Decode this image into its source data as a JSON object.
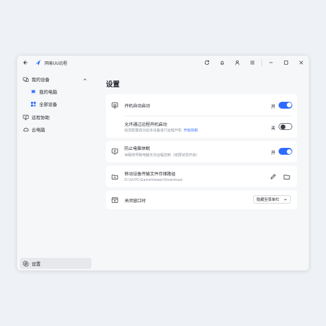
{
  "app": {
    "title": "网易UU远程"
  },
  "sidebar": {
    "items": [
      {
        "label": "我的设备"
      },
      {
        "label": "我的电脑"
      },
      {
        "label": "全部设备"
      },
      {
        "label": "远程协助"
      },
      {
        "label": "云电脑"
      }
    ],
    "settings_label": "设置"
  },
  "page": {
    "title": "设置"
  },
  "settings": {
    "auto_start": {
      "title": "开机自动启动",
      "state": "开"
    },
    "remote_boot": {
      "title": "允许通过远程开机启动",
      "subtitle": "给您配置成功后本设备进行远程开机",
      "link": "开始协助",
      "state": "关"
    },
    "prevent_sleep": {
      "title": "防止电脑休眠",
      "subtitle": "休眠将导致电脑无法远程控制（熄屏状态开启）",
      "state": "开"
    },
    "download_path": {
      "title": "移动设备传输文件存储路径",
      "path": "D:\\UUYC\\GameViewer\\Download"
    },
    "close_window": {
      "title": "关闭窗口时",
      "option": "隐藏至菜单栏"
    }
  },
  "colors": {
    "accent": "#2f6bff",
    "background": "#eef1f5"
  }
}
